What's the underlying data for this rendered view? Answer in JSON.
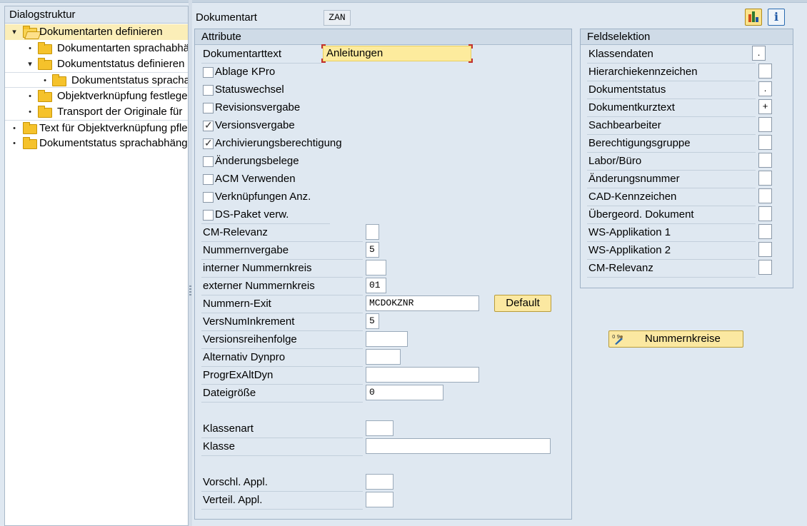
{
  "tree": {
    "header": "Dialogstruktur",
    "items": [
      {
        "label": "Dokumentarten definieren",
        "level": 0,
        "expanded": true,
        "selected": true
      },
      {
        "label": "Dokumentarten sprachabhängig",
        "level": 1
      },
      {
        "label": "Dokumentstatus definieren",
        "level": 1,
        "expanded": true
      },
      {
        "label": "Dokumentstatus sprachabhängig",
        "level": 2
      },
      {
        "label": "Objektverknüpfung festlegen",
        "level": 1
      },
      {
        "label": "Transport der Originale für",
        "level": 1
      },
      {
        "label": "Text für Objektverknüpfung pflegen",
        "level": 0
      },
      {
        "label": "Dokumentstatus sprachabhängig",
        "level": 0
      }
    ]
  },
  "header": {
    "doc_type_label": "Dokumentart",
    "doc_type_value": "ZAN"
  },
  "attribute": {
    "title": "Attribute",
    "doc_text_label": "Dokumentarttext",
    "doc_text_value": "Anleitungen",
    "checkboxes": [
      {
        "label": "Ablage KPro",
        "checked": false
      },
      {
        "label": "Statuswechsel",
        "checked": false
      },
      {
        "label": "Revisionsvergabe",
        "checked": false
      },
      {
        "label": "Versionsvergabe",
        "checked": true
      },
      {
        "label": "Archivierungsberechtigung",
        "checked": true
      },
      {
        "label": "Änderungsbelege",
        "checked": false
      },
      {
        "label": "ACM Verwenden",
        "checked": false
      },
      {
        "label": "Verknüpfungen Anz.",
        "checked": false
      },
      {
        "label": "DS-Paket verw.",
        "checked": false
      }
    ],
    "fields": [
      {
        "label": "CM-Relevanz",
        "value": ""
      },
      {
        "label": "Nummernvergabe",
        "value": "5"
      },
      {
        "label": "interner Nummernkreis",
        "value": ""
      },
      {
        "label": "externer Nummernkreis",
        "value": "01"
      },
      {
        "label": "Nummern-Exit",
        "value": "MCDOKZNR"
      },
      {
        "label": "VersNumInkrement",
        "value": "5"
      },
      {
        "label": "Versionsreihenfolge",
        "value": ""
      },
      {
        "label": "Alternativ Dynpro",
        "value": ""
      },
      {
        "label": "ProgrExAltDyn",
        "value": ""
      },
      {
        "label": "Dateigröße",
        "value": "0"
      },
      {
        "label": "Klassenart",
        "value": ""
      },
      {
        "label": "Klasse",
        "value": ""
      },
      {
        "label": "Vorschl. Appl.",
        "value": ""
      },
      {
        "label": "Verteil. Appl.",
        "value": ""
      }
    ],
    "default_button": "Default"
  },
  "feldselektion": {
    "title": "Feldselektion",
    "items": [
      {
        "label": "Klassendaten",
        "value": "."
      },
      {
        "label": "Hierarchiekennzeichen",
        "value": ""
      },
      {
        "label": "Dokumentstatus",
        "value": "."
      },
      {
        "label": "Dokumentkurztext",
        "value": "+"
      },
      {
        "label": "Sachbearbeiter",
        "value": ""
      },
      {
        "label": "Berechtigungsgruppe",
        "value": ""
      },
      {
        "label": "Labor/Büro",
        "value": ""
      },
      {
        "label": "Änderungsnummer",
        "value": ""
      },
      {
        "label": "CAD-Kennzeichen",
        "value": ""
      },
      {
        "label": "Übergeord. Dokument",
        "value": ""
      },
      {
        "label": "WS-Applikation 1",
        "value": ""
      },
      {
        "label": "WS-Applikation 2",
        "value": ""
      },
      {
        "label": "CM-Relevanz",
        "value": ""
      }
    ]
  },
  "nummernkreise_button": "Nummernkreise",
  "icons": {
    "toolbar_1": "chart-icon",
    "toolbar_2": "info-icon",
    "nummernkreise": "number-range-icon"
  }
}
